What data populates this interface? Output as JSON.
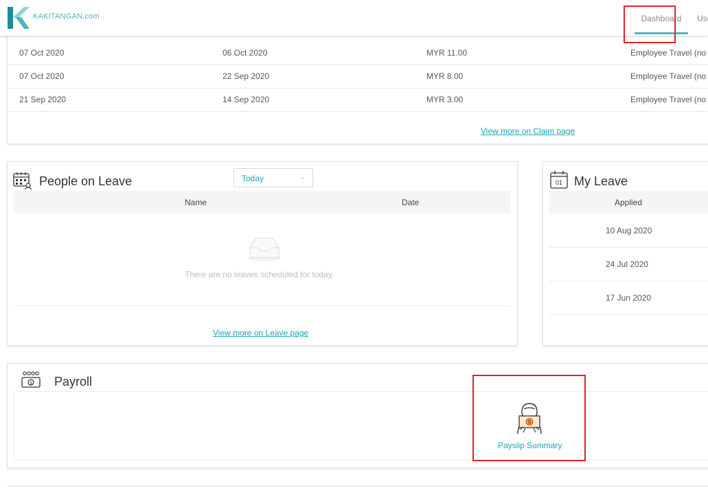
{
  "header": {
    "brand": "KAKITANGAN.com",
    "nav": {
      "dashboard": "Dashboard",
      "users": "Users"
    },
    "accent": "#4fb3bf"
  },
  "claims": {
    "rows": [
      {
        "submitted": "07 Oct 2020",
        "claim_date": "06 Oct 2020",
        "amount": "MYR 11.00",
        "type": "Employee Travel (no"
      },
      {
        "submitted": "07 Oct 2020",
        "claim_date": "22 Sep 2020",
        "amount": "MYR 8.00",
        "type": "Employee Travel (no"
      },
      {
        "submitted": "21 Sep 2020",
        "claim_date": "14 Sep 2020",
        "amount": "MYR 3.00",
        "type": "Employee Travel (no"
      }
    ],
    "view_more": "View more on Claim page"
  },
  "people_on_leave": {
    "title": "People on Leave",
    "filter": "Today",
    "columns": {
      "name": "Name",
      "date": "Date"
    },
    "empty": "There are no leaves scheduled for today.",
    "view_more": "View more on Leave page"
  },
  "my_leave": {
    "title": "My Leave",
    "icon_text": "01",
    "column": "Applied",
    "rows": [
      "10 Aug 2020",
      "24 Jul 2020",
      "17 Jun 2020"
    ]
  },
  "payroll": {
    "title": "Payroll",
    "payslip_label": "Payslip Summary"
  }
}
